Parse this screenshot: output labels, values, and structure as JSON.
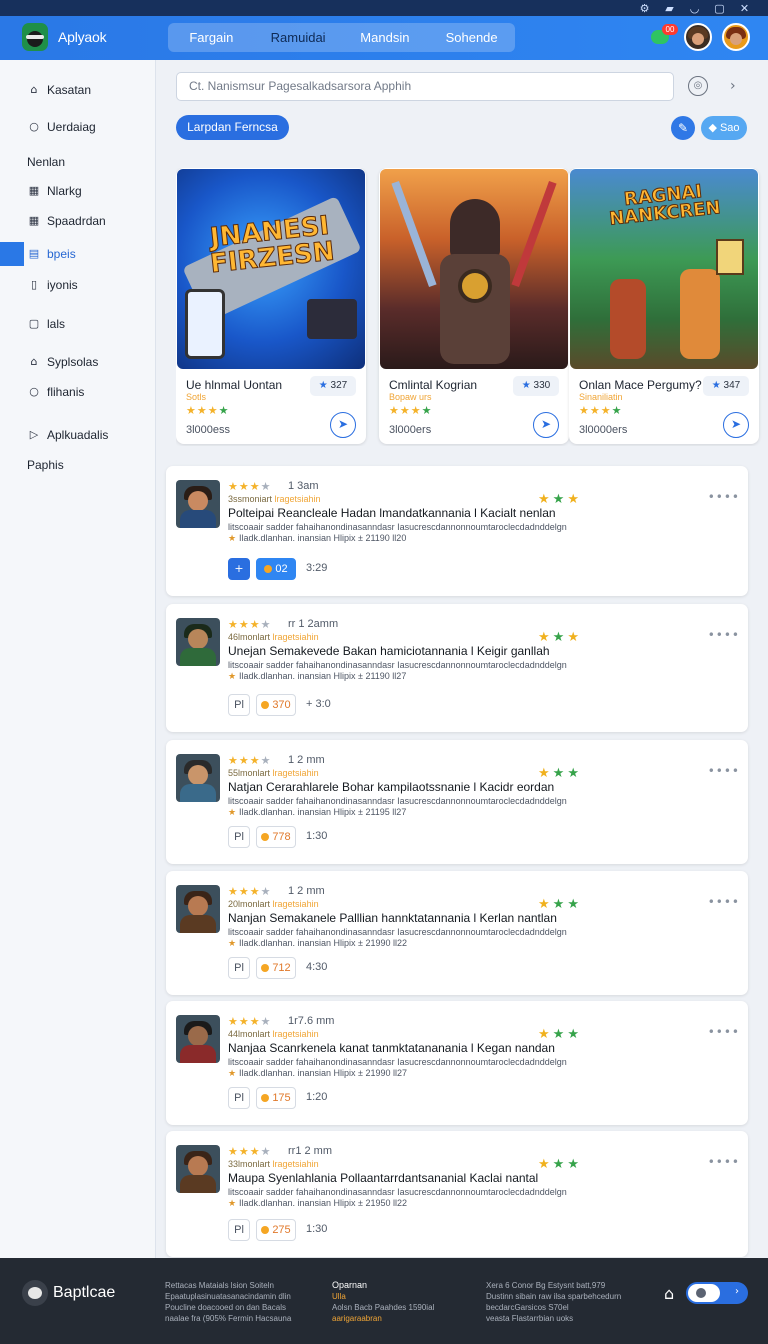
{
  "app": {
    "name": "Aplyaok"
  },
  "titlebar": {
    "icons": [
      "settings-icon",
      "chart-icon",
      "user-icon",
      "window-icon",
      "close-icon"
    ]
  },
  "header": {
    "tabs": [
      {
        "label": "Fargain",
        "active": false
      },
      {
        "label": "Ramuidai",
        "active": true
      },
      {
        "label": "Mandsin",
        "active": false
      },
      {
        "label": "Sohende",
        "active": false
      }
    ],
    "chat_badge": "00"
  },
  "sidebar": {
    "items": [
      {
        "label": "Kasatan",
        "icon": "home-icon",
        "type": "item"
      },
      {
        "label": "Uerdaiag",
        "icon": "circle-icon",
        "type": "item"
      },
      {
        "label": "Nenlan",
        "type": "heading"
      },
      {
        "label": "Nlarkg",
        "icon": "grid-icon",
        "type": "item"
      },
      {
        "label": "Spaadrdan",
        "icon": "grid-icon",
        "type": "item"
      },
      {
        "label": "bpeis",
        "icon": "calendar-icon",
        "type": "item",
        "active": true
      },
      {
        "label": "iyonis",
        "icon": "doc-icon",
        "type": "item"
      },
      {
        "label": "lals",
        "icon": "square-icon",
        "type": "item"
      },
      {
        "label": "Syplsolas",
        "icon": "home-icon",
        "type": "item"
      },
      {
        "label": "flihanis",
        "icon": "circle-icon",
        "type": "item"
      },
      {
        "label": "Aplkuadalis",
        "icon": "play-icon",
        "type": "item"
      },
      {
        "label": "Paphis",
        "type": "heading"
      }
    ]
  },
  "search": {
    "placeholder": "Ct. Nanismsur Pagesalkadsarsora Apphih"
  },
  "toolbar": {
    "primary_label": "Larpdan Ferncsa",
    "small_label": "Sao"
  },
  "cards": [
    {
      "art_text": "JNANESI FIRZESN",
      "title": "Ue hlnmal Uontan",
      "sub": "Sotls",
      "stars": 4,
      "rating": "327",
      "count": "3l000ess",
      "theme": "blue"
    },
    {
      "art_text": "",
      "title": "Cmlintal Kogrian",
      "sub": "Bopaw urs",
      "stars": 4,
      "rating": "330",
      "count": "3l000ers",
      "theme": "dusk"
    },
    {
      "art_text": "RAGNAI NANKCREN",
      "title": "Onlan Mace Pergumy?",
      "sub": "Sinaniliatin",
      "stars": 4,
      "rating": "347",
      "count": "3l0000ers",
      "theme": "jungle"
    }
  ],
  "posts": [
    {
      "stars": 4,
      "time": "1 3am",
      "meta": "3ssmoniart",
      "tag": "lragetsiahin",
      "title": "Polteipai Reancleale Hadan lmandatkannania l Kacialt nenlan",
      "desc": "litscoaair sadder fahaihanondinasanndasr Iasucrescdannonnoumtaroclecdadnddelgn",
      "foot": "Iladk.dlanhan. inansian Hlipix ± 21190 ll20",
      "btn1": "+",
      "btn2": "02",
      "btn3": "3:29",
      "blue": true,
      "avatar": "navy"
    },
    {
      "stars": 4,
      "time": "rr 1 2amm",
      "meta": "46lmonlart",
      "tag": "lragetsiahin",
      "title": "Unejan Semakevede Bakan hamiciotannania l Keigir ganllah",
      "desc": "litscoaair sadder fahaihanondinasanndasr Iasucrescdannonnoumtaroclecdadnddelgn",
      "foot": "Iladk.dlanhan. inansian Hlipix ± 21190 ll27",
      "btn1": "Pl",
      "btn2": "370",
      "btn3": "+ 3:0",
      "blue": false,
      "avatar": "green"
    },
    {
      "stars": 4,
      "time": "1 2 mm",
      "meta": "55lmonlart",
      "tag": "lragetsiahin",
      "title": "Natjan Cerarahlarele Bohar kampilaotssnanie l Kacidr eordan",
      "desc": "litscoaair sadder fahaihanondinasanndasr Iasucrescdannonnoumtaroclecdadnddelgn",
      "foot": "Iladk.dlanhan. inansian Hlipix ± 21195 ll27",
      "btn1": "Pl",
      "btn2": "778",
      "btn3": "1:30",
      "blue": false,
      "avatar": "steel"
    },
    {
      "stars": 4,
      "time": "1 2 mm",
      "meta": "20lmonlart",
      "tag": "lragetsiahin",
      "title": "Nanjan Semakanele Palllian hannktatannania l Kerlan nantlan",
      "desc": "litscoaair sadder fahaihanondinasanndasr Iasucrescdannonnoumtaroclecdadnddelgn",
      "foot": "Iladk.dlanhan. inansian Hlipix ± 21990 ll22",
      "btn1": "Pl",
      "btn2": "712",
      "btn3": "4:30",
      "blue": false,
      "avatar": "brown"
    },
    {
      "stars": 4,
      "time": "1r7.6 mm",
      "meta": "44lmonlart",
      "tag": "lragetsiahin",
      "title": "Nanjaa Scanrkenela kanat tanmktatananania l Kegan nandan",
      "desc": "litscoaair sadder fahaihanondinasanndasr Iasucrescdannonnoumtaroclecdadnddelgn",
      "foot": "Iladk.dlanhan. inansian Hlipix ± 21990 ll27",
      "btn1": "Pl",
      "btn2": "175",
      "btn3": "1:20",
      "blue": false,
      "avatar": "red"
    },
    {
      "stars": 4,
      "time": "rr1 2 mm",
      "meta": "33lmonlart",
      "tag": "lragetsiahin",
      "title": "Maupa Syenlahlania Pollaantarrdantsananial Kaclai nantal",
      "desc": "litscoaair sadder fahaihanondinasanndasr Iasucrescdannonnoumtaroclecdadnddelgn",
      "foot": "Iladk.dlanhan. inansian Hlipix ± 21950 ll22",
      "btn1": "Pl",
      "btn2": "275",
      "btn3": "1:30",
      "blue": false,
      "avatar": "brown"
    }
  ],
  "footer": {
    "name": "Baptlcae",
    "col1": [
      "Rettacas Mataials lsion Soiteln",
      "Epaatuplasinuatasanacindamin dlin",
      "Poucline doacooed on dan Bacals",
      "naalae fra (905% Fermin Hacsauna"
    ],
    "col2_heading": "Oparnan",
    "col2": [
      "Ulla",
      "Aolsn Bacb Paahdes 1590ial",
      "aarigaraabran"
    ],
    "col3": [
      "Xera 6 Conor Bg Estysnt batt,979",
      "Dustinn sibain raw ilsa sparbehcedurn",
      "becdarcGarsicos S70el",
      "veasta Flastarrbian uoks"
    ]
  }
}
